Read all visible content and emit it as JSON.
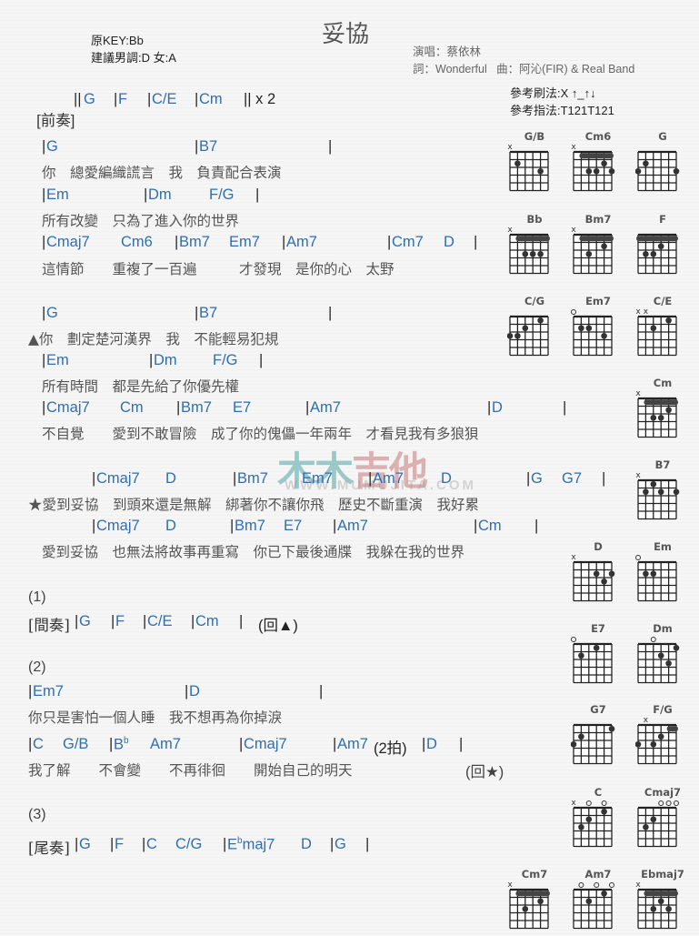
{
  "header": {
    "original_key": "原KEY:Bb",
    "suggested_key": "建議男調:D 女:A",
    "title": "妥協",
    "singer": "演唱：蔡依林",
    "credits": "詞：Wonderful   曲：阿沁(FIR) & Real Band",
    "strum": "參考刷法:X ↑_↑↓",
    "finger": "參考指法:T121T121"
  },
  "watermark": {
    "text_a": "木木",
    "text_b": "吉他",
    "url": "WWW.MUMUJITA.COM"
  },
  "sections": {
    "intro": {
      "label": "[前奏]",
      "bars": "||",
      "chords": [
        "G",
        "F",
        "C/E",
        "Cm"
      ],
      "repeat": "|| x 2"
    },
    "verse1": [
      {
        "chords": [
          {
            "t": "|",
            "c": ""
          },
          {
            "t": "G",
            "c": "ch"
          },
          {
            "t": "|",
            "c": ""
          },
          {
            "t": "B7",
            "c": "ch"
          },
          {
            "t": "|",
            "c": ""
          }
        ],
        "lyric": "你　總愛編織謊言　我　負責配合表演"
      },
      {
        "chords": [
          {
            "t": "|",
            "c": ""
          },
          {
            "t": "Em",
            "c": "ch"
          },
          {
            "t": "|",
            "c": ""
          },
          {
            "t": "Dm",
            "c": "ch"
          },
          {
            "t": "F/G",
            "c": "ch"
          },
          {
            "t": "|",
            "c": ""
          }
        ],
        "lyric": "所有改變　只為了進入你的世界"
      },
      {
        "chords": [
          {
            "t": "|",
            "c": ""
          },
          {
            "t": "Cmaj7",
            "c": "ch"
          },
          {
            "t": "Cm6",
            "c": "ch"
          },
          {
            "t": "|",
            "c": ""
          },
          {
            "t": "Bm7",
            "c": "ch"
          },
          {
            "t": "Em7",
            "c": "ch"
          },
          {
            "t": "|",
            "c": ""
          },
          {
            "t": "Am7",
            "c": "ch"
          },
          {
            "t": "|",
            "c": ""
          },
          {
            "t": "Cm7",
            "c": "ch"
          },
          {
            "t": "D",
            "c": "ch"
          },
          {
            "t": "|",
            "c": ""
          }
        ],
        "lyric": "這情節　　重複了一百遍　　　才發現　是你的心　太野"
      }
    ],
    "verse2": [
      {
        "chords": [
          {
            "t": "G",
            "c": "ch"
          },
          {
            "t": "B7",
            "c": "ch"
          }
        ],
        "lyric": "▲你　劃定楚河漢界　我　不能輕易犯規"
      },
      {
        "chords": [
          {
            "t": "Em",
            "c": "ch"
          },
          {
            "t": "Dm",
            "c": "ch"
          },
          {
            "t": "F/G",
            "c": "ch"
          }
        ],
        "lyric": "所有時間　都是先給了你優先權"
      },
      {
        "chords": [
          {
            "t": "Cmaj7",
            "c": "ch"
          },
          {
            "t": "Cm",
            "c": "ch"
          },
          {
            "t": "Bm7",
            "c": "ch"
          },
          {
            "t": "E7",
            "c": "ch"
          },
          {
            "t": "Am7",
            "c": "ch"
          },
          {
            "t": "D",
            "c": "ch"
          }
        ],
        "lyric": "不自覺　　愛到不敢冒險　成了你的傀儡一年兩年　才看見我有多狼狽"
      }
    ],
    "chorus": [
      {
        "chords": [
          "Cmaj7",
          "D",
          "Bm7",
          "Em7",
          "Am7",
          "D",
          "G",
          "G7"
        ],
        "lyric": "★愛到妥協　到頭來還是無解　綁著你不讓你飛　歷史不斷重演　我好累"
      },
      {
        "chords": [
          "Cmaj7",
          "D",
          "Bm7",
          "E7",
          "Am7",
          "Cm"
        ],
        "lyric": "愛到妥協　也無法將故事再重寫　你已下最後通牒　我躲在我的世界"
      }
    ],
    "part1": {
      "number": "(1)",
      "label": "[間奏]",
      "chords": [
        "G",
        "F",
        "C/E",
        "Cm"
      ],
      "back": "(回▲)"
    },
    "part2": {
      "number": "(2)",
      "line1_chords": [
        "Em7",
        "D"
      ],
      "line1_lyric": "你只是害怕一個人睡　我不想再為你掉淚",
      "line2_chords": [
        "C",
        "G/B",
        "B",
        "b",
        "Am7",
        "Cmaj7",
        "Am7",
        "D"
      ],
      "beat_note": "(2拍)",
      "line2_lyric": "我了解　　不會變　　不再徘徊　　開始自己的明天",
      "back": "(回★)"
    },
    "part3": {
      "number": "(3)",
      "label": "[尾奏]",
      "chords": [
        "G",
        "F",
        "C",
        "C/G",
        "E",
        "b",
        "maj7",
        "D",
        "G"
      ]
    }
  },
  "chord_diagrams": [
    {
      "name": "G/B",
      "mute": [
        1
      ],
      "open": [],
      "barre": null,
      "fret_label": "",
      "dots": [
        [
          2,
          2
        ],
        [
          5,
          3
        ]
      ]
    },
    {
      "name": "Cm6",
      "mute": [
        1
      ],
      "open": [],
      "barre": {
        "fret": 1,
        "from": 2,
        "to": 6
      },
      "fret_label": "3",
      "dots": [
        [
          3,
          3
        ],
        [
          4,
          3
        ],
        [
          5,
          2
        ],
        [
          6,
          3
        ]
      ]
    },
    {
      "name": "G",
      "mute": [],
      "open": [],
      "barre": null,
      "fret_label": "",
      "dots": [
        [
          1,
          3
        ],
        [
          2,
          2
        ],
        [
          6,
          3
        ]
      ]
    },
    {
      "name": "Bb",
      "mute": [
        1
      ],
      "open": [],
      "barre": {
        "fret": 1,
        "from": 2,
        "to": 6
      },
      "fret_label": "",
      "dots": [
        [
          3,
          3
        ],
        [
          4,
          3
        ],
        [
          5,
          3
        ]
      ]
    },
    {
      "name": "Bm7",
      "mute": [
        1
      ],
      "open": [],
      "barre": {
        "fret": 1,
        "from": 2,
        "to": 6
      },
      "fret_label": "2",
      "dots": [
        [
          3,
          3
        ],
        [
          5,
          2
        ]
      ]
    },
    {
      "name": "F",
      "mute": [],
      "open": [],
      "barre": {
        "fret": 1,
        "from": 1,
        "to": 6
      },
      "fret_label": "",
      "dots": [
        [
          2,
          3
        ],
        [
          3,
          3
        ],
        [
          4,
          2
        ]
      ]
    },
    {
      "name": "C/G",
      "mute": [],
      "open": [],
      "barre": null,
      "fret_label": "",
      "dots": [
        [
          1,
          3
        ],
        [
          2,
          3
        ],
        [
          3,
          2
        ],
        [
          5,
          1
        ]
      ]
    },
    {
      "name": "Em7",
      "mute": [],
      "open": [
        1
      ],
      "barre": null,
      "fret_label": "",
      "dots": [
        [
          2,
          2
        ],
        [
          3,
          2
        ],
        [
          5,
          3
        ]
      ]
    },
    {
      "name": "C/E",
      "mute": [
        1,
        2
      ],
      "open": [],
      "barre": null,
      "fret_label": "",
      "dots": [
        [
          3,
          2
        ],
        [
          5,
          1
        ]
      ]
    },
    {
      "name": "Cm",
      "mute": [
        1
      ],
      "open": [],
      "barre": {
        "fret": 1,
        "from": 2,
        "to": 6
      },
      "fret_label": "3",
      "dots": [
        [
          3,
          3
        ],
        [
          4,
          3
        ],
        [
          5,
          2
        ]
      ]
    },
    {
      "name": "B7",
      "mute": [
        1
      ],
      "open": [],
      "barre": null,
      "fret_label": "",
      "dots": [
        [
          2,
          2
        ],
        [
          3,
          1
        ],
        [
          4,
          2
        ],
        [
          6,
          2
        ]
      ]
    },
    {
      "name": "D",
      "mute": [
        1
      ],
      "open": [],
      "barre": null,
      "fret_label": "",
      "dots": [
        [
          4,
          2
        ],
        [
          5,
          3
        ],
        [
          6,
          2
        ]
      ]
    },
    {
      "name": "Em",
      "mute": [],
      "open": [
        1
      ],
      "barre": null,
      "fret_label": "",
      "dots": [
        [
          2,
          2
        ],
        [
          3,
          2
        ]
      ]
    },
    {
      "name": "E7",
      "mute": [],
      "open": [
        1
      ],
      "barre": null,
      "fret_label": "",
      "dots": [
        [
          2,
          2
        ],
        [
          4,
          1
        ]
      ]
    },
    {
      "name": "Dm",
      "mute": [],
      "open": [
        3
      ],
      "barre": null,
      "fret_label": "",
      "dots": [
        [
          4,
          2
        ],
        [
          5,
          3
        ],
        [
          6,
          1
        ]
      ]
    },
    {
      "name": "G7",
      "mute": [],
      "open": [],
      "barre": null,
      "fret_label": "",
      "dots": [
        [
          1,
          3
        ],
        [
          2,
          2
        ],
        [
          6,
          1
        ]
      ]
    },
    {
      "name": "F/G",
      "mute": [
        2
      ],
      "open": [],
      "barre": {
        "fret": 1,
        "from": 5,
        "to": 6
      },
      "fret_label": "",
      "dots": [
        [
          1,
          3
        ],
        [
          3,
          3
        ],
        [
          4,
          2
        ]
      ]
    },
    {
      "name": "C",
      "mute": [
        1
      ],
      "open": [
        3,
        5
      ],
      "barre": null,
      "fret_label": "",
      "dots": [
        [
          2,
          3
        ],
        [
          3,
          2
        ],
        [
          5,
          1
        ]
      ]
    },
    {
      "name": "Cmaj7",
      "mute": [],
      "open": [
        4,
        5,
        6
      ],
      "barre": null,
      "fret_label": "",
      "dots": [
        [
          2,
          3
        ],
        [
          3,
          2
        ]
      ]
    },
    {
      "name": "Cm7",
      "mute": [
        1
      ],
      "open": [],
      "barre": {
        "fret": 1,
        "from": 2,
        "to": 6
      },
      "fret_label": "3",
      "dots": [
        [
          3,
          3
        ],
        [
          5,
          2
        ]
      ]
    },
    {
      "name": "Am7",
      "mute": [],
      "open": [
        2,
        4,
        6
      ],
      "barre": null,
      "fret_label": "",
      "dots": [
        [
          3,
          2
        ],
        [
          5,
          1
        ]
      ]
    },
    {
      "name": "Ebmaj7",
      "mute": [
        1
      ],
      "open": [],
      "barre": {
        "fret": 1,
        "from": 2,
        "to": 6
      },
      "fret_label": "6",
      "dots": [
        [
          3,
          3
        ],
        [
          4,
          2
        ],
        [
          5,
          3
        ]
      ]
    }
  ]
}
